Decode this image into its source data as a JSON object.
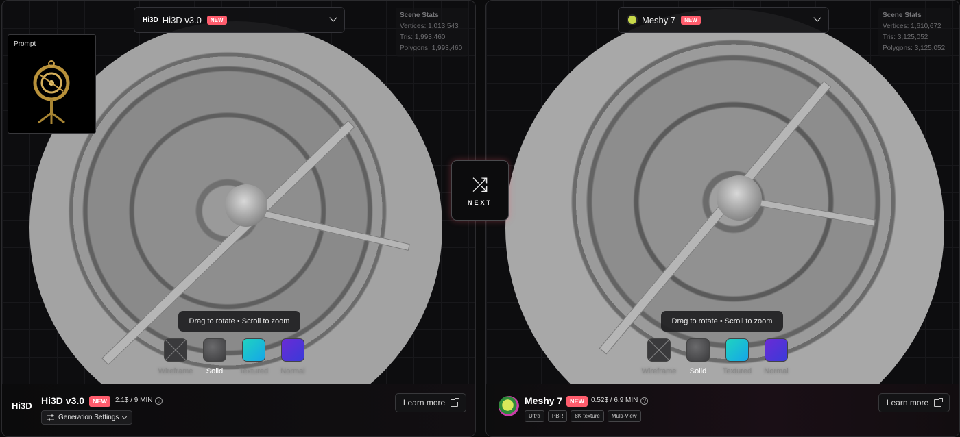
{
  "left": {
    "selector": {
      "logo": "Hi3D",
      "name": "Hi3D v3.0",
      "badge": "NEW"
    },
    "stats": {
      "title": "Scene Stats",
      "vertices": "Vertices: 1,013,543",
      "tris": "Tris: 1,993,460",
      "polygons": "Polygons: 1,993,460"
    },
    "prompt_label": "Prompt",
    "hint": "Drag to rotate • Scroll to zoom",
    "modes": [
      "Wireframe",
      "Solid",
      "Textured",
      "Normal"
    ],
    "active_mode": "Solid",
    "footer": {
      "logo": "Hi3D",
      "name": "Hi3D v3.0",
      "badge": "NEW",
      "price": "2.1$ / 9 MIN",
      "settings_label": "Generation Settings",
      "learn_more": "Learn more"
    }
  },
  "right": {
    "selector": {
      "name": "Meshy 7",
      "badge": "NEW"
    },
    "stats": {
      "title": "Scene Stats",
      "vertices": "Vertices: 1,610,672",
      "tris": "Tris: 3,125,052",
      "polygons": "Polygons: 3,125,052"
    },
    "hint": "Drag to rotate • Scroll to zoom",
    "modes": [
      "Wireframe",
      "Solid",
      "Textured",
      "Normal"
    ],
    "active_mode": "Solid",
    "footer": {
      "name": "Meshy 7",
      "badge": "NEW",
      "price": "0.52$ / 6.9 MIN",
      "tags": [
        "Ultra",
        "PBR",
        "8K texture",
        "Multi-View"
      ],
      "learn_more": "Learn more"
    }
  },
  "next_label": "NEXT",
  "colors": {
    "badge": "#ff5c6c",
    "textured": "#1fd3c0",
    "normal": "#6a2bd6"
  }
}
